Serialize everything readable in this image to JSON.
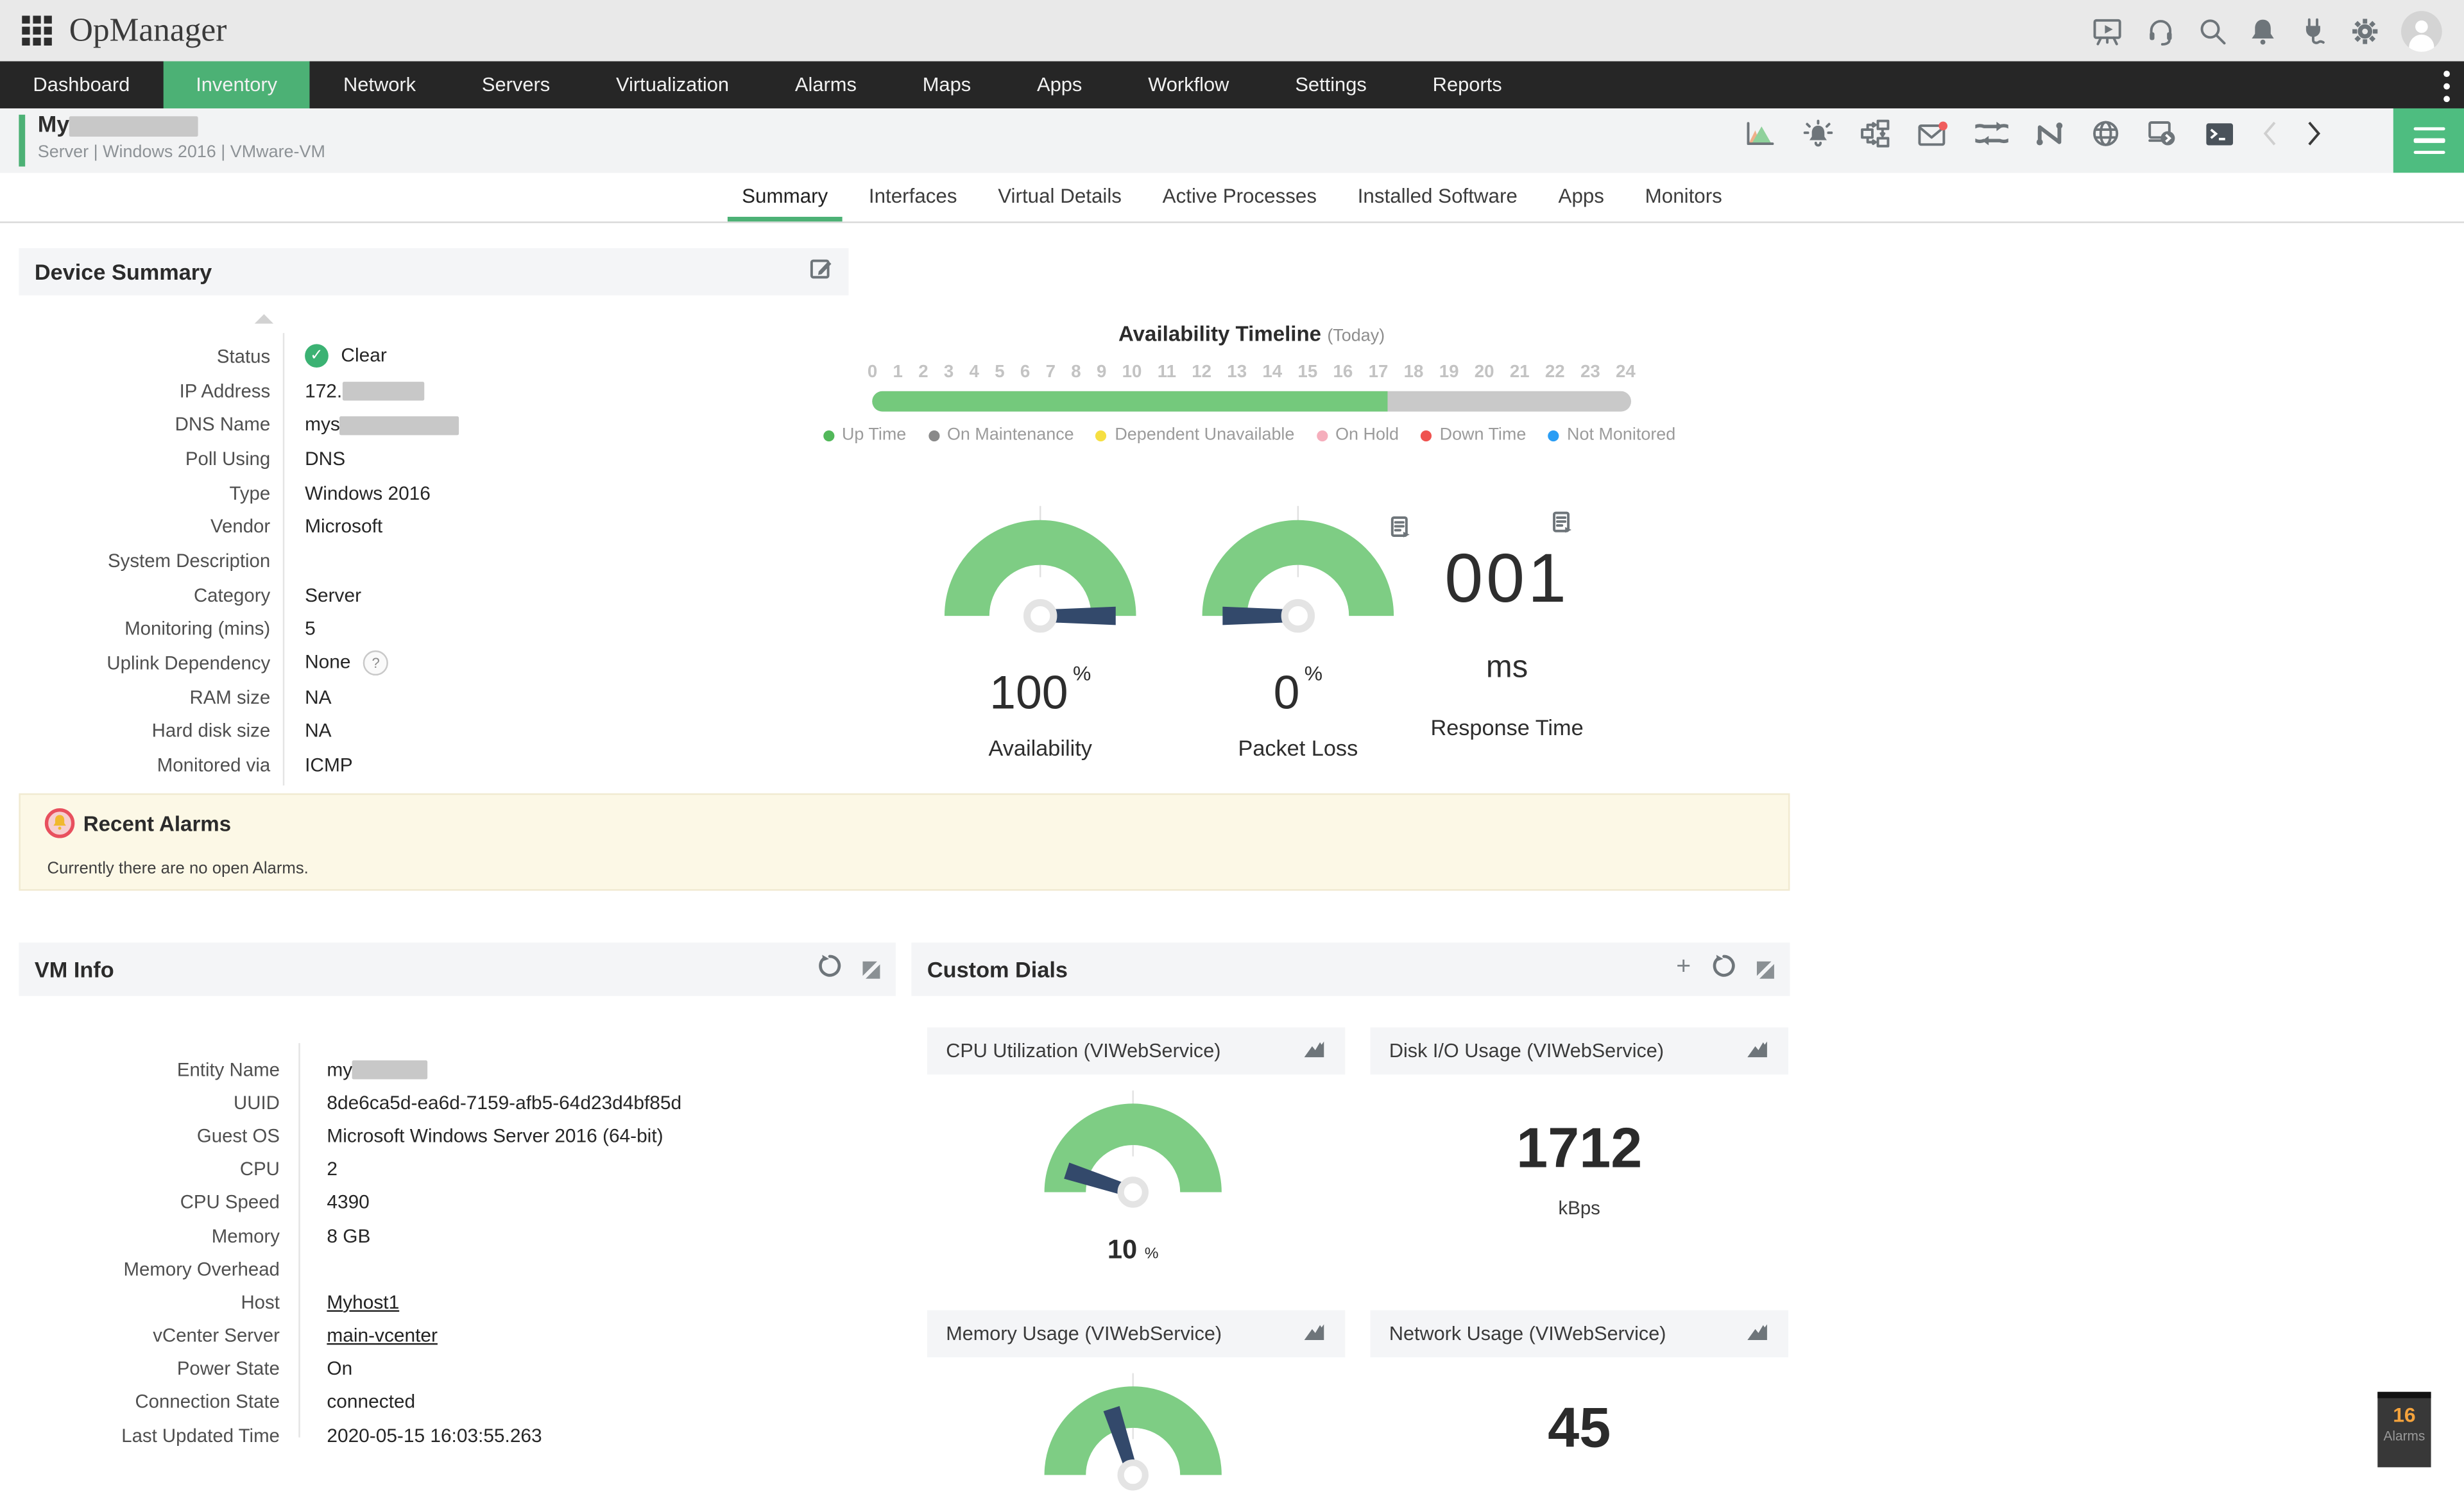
{
  "topbar": {
    "logo_text": "OpManager"
  },
  "nav": {
    "items": [
      {
        "label": "Dashboard"
      },
      {
        "label": "Inventory"
      },
      {
        "label": "Network"
      },
      {
        "label": "Servers"
      },
      {
        "label": "Virtualization"
      },
      {
        "label": "Alarms"
      },
      {
        "label": "Maps"
      },
      {
        "label": "Apps"
      },
      {
        "label": "Workflow"
      },
      {
        "label": "Settings"
      },
      {
        "label": "Reports"
      }
    ],
    "active": "Inventory"
  },
  "device_header": {
    "name_prefix": "My",
    "breadcrumb": "Server | Windows 2016  | VMware-VM"
  },
  "tabs": [
    {
      "label": "Summary"
    },
    {
      "label": "Interfaces"
    },
    {
      "label": "Virtual Details"
    },
    {
      "label": "Active Processes"
    },
    {
      "label": "Installed Software"
    },
    {
      "label": "Apps"
    },
    {
      "label": "Monitors"
    }
  ],
  "device_summary": {
    "title": "Device Summary",
    "fields": {
      "status_label": "Status",
      "status_value": "Clear",
      "ip_label": "IP Address",
      "ip_prefix": "172.",
      "dns_label": "DNS Name",
      "dns_prefix": "mys",
      "poll_label": "Poll Using",
      "poll_value": "DNS",
      "type_label": "Type",
      "type_value": "Windows 2016",
      "vendor_label": "Vendor",
      "vendor_value": "Microsoft",
      "sysdesc_label": "System Description",
      "sysdesc_value": "",
      "category_label": "Category",
      "category_value": "Server",
      "monitoring_label": "Monitoring (mins)",
      "monitoring_value": "5",
      "uplink_label": "Uplink Dependency",
      "uplink_value": "None",
      "uplink_help": "?",
      "ram_label": "RAM size",
      "ram_value": "NA",
      "disk_label": "Hard disk size",
      "disk_value": "NA",
      "monitored_label": "Monitored via",
      "monitored_value": "ICMP"
    }
  },
  "availability_timeline": {
    "title": "Availability Timeline",
    "subtitle": "(Today)",
    "hours_total": 24,
    "up_hours": 16.3,
    "tick_labels": [
      0,
      1,
      2,
      3,
      4,
      5,
      6,
      7,
      8,
      9,
      10,
      11,
      12,
      13,
      14,
      15,
      16,
      17,
      18,
      19,
      20,
      21,
      22,
      23,
      24
    ],
    "bar_up_color": "#74c97c",
    "bar_rest_color": "#c9c9c9",
    "legend": [
      {
        "label": "Up Time",
        "color": "#52b85a"
      },
      {
        "label": "On Maintenance",
        "color": "#8a8a8a"
      },
      {
        "label": "Dependent Unavailable",
        "color": "#f6df42"
      },
      {
        "label": "On Hold",
        "color": "#f5aebc"
      },
      {
        "label": "Down Time",
        "color": "#ef5350"
      },
      {
        "label": "Not Monitored",
        "color": "#2a9df4"
      }
    ]
  },
  "metrics": {
    "availability": {
      "value": 100,
      "unit": "%",
      "label": "Availability"
    },
    "packet_loss": {
      "value": 0,
      "unit": "%",
      "label": "Packet Loss"
    },
    "response_time": {
      "display": "001",
      "unit": "ms",
      "label": "Response Time"
    }
  },
  "recent_alarms": {
    "title": "Recent Alarms",
    "message": "Currently there are no open Alarms."
  },
  "vm_info": {
    "title": "VM Info",
    "fields": {
      "entity_label": "Entity Name",
      "entity_prefix": "my",
      "uuid_label": "UUID",
      "uuid_value": "8de6ca5d-ea6d-7159-afb5-64d23d4bf85d",
      "guestos_label": "Guest OS",
      "guestos_value": "Microsoft Windows Server 2016 (64-bit)",
      "cpu_label": "CPU",
      "cpu_value": "2",
      "cpuspeed_label": "CPU Speed",
      "cpuspeed_value": "4390",
      "memory_label": "Memory",
      "memory_value": "8 GB",
      "memoverhead_label": "Memory Overhead",
      "memoverhead_value": "",
      "host_label": "Host",
      "host_value": "Myhost1",
      "vcenter_label": "vCenter Server",
      "vcenter_value": "main-vcenter",
      "power_label": "Power State",
      "power_value": "On",
      "conn_label": "Connection State",
      "conn_value": "connected",
      "updated_label": "Last Updated Time",
      "updated_value": "2020-05-15 16:03:55.263"
    }
  },
  "custom_dials": {
    "title": "Custom Dials",
    "cpu": {
      "title": "CPU Utilization (VIWebService)",
      "value": 10,
      "unit": "%"
    },
    "disk": {
      "title": "Disk I/O Usage (VIWebService)",
      "value": "1712",
      "unit": "kBps"
    },
    "memory": {
      "title": "Memory Usage (VIWebService)",
      "value": 40
    },
    "network": {
      "title": "Network Usage (VIWebService)",
      "value": "45"
    }
  },
  "alarm_badge": {
    "count": "16",
    "label": "Alarms"
  },
  "colors": {
    "accent_green": "#4cb175",
    "gauge_green": "#7ecd84",
    "needle_blue": "#33496b",
    "alarms_bg": "#fcf8e6",
    "badge_orange": "#f5a33c"
  }
}
